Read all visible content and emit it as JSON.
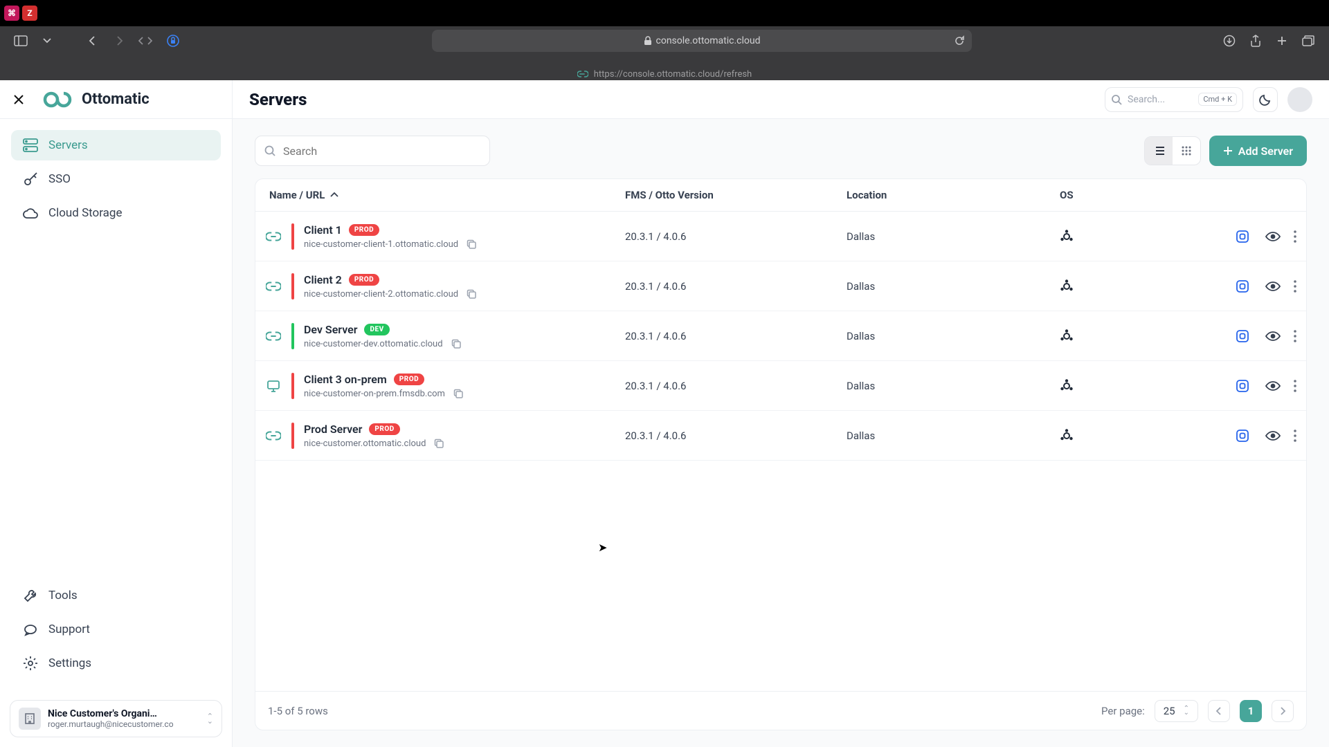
{
  "browser": {
    "url_display": "console.ottomatic.cloud",
    "secondary_url": "https://console.ottomatic.cloud/refresh"
  },
  "app": {
    "brand": "Ottomatic",
    "page_title": "Servers"
  },
  "sidebar": {
    "items": [
      {
        "label": "Servers"
      },
      {
        "label": "SSO"
      },
      {
        "label": "Cloud Storage"
      }
    ],
    "bottom_items": [
      {
        "label": "Tools"
      },
      {
        "label": "Support"
      },
      {
        "label": "Settings"
      }
    ],
    "org": {
      "name": "Nice Customer's Organi…",
      "email": "roger.murtaugh@nicecustomer.co"
    }
  },
  "header": {
    "search_placeholder": "Search...",
    "search_kbd": "Cmd  +  K"
  },
  "toolbar": {
    "filter_placeholder": "Search",
    "add_label": "Add Server"
  },
  "columns": {
    "name": "Name / URL",
    "version": "FMS / Otto Version",
    "location": "Location",
    "os": "OS"
  },
  "servers": [
    {
      "name": "Client 1",
      "env": "PROD",
      "env_class": "prod",
      "url": "nice-customer-client-1.ottomatic.cloud",
      "version": "20.3.1 / 4.0.6",
      "location": "Dallas",
      "type": "cloud"
    },
    {
      "name": "Client 2",
      "env": "PROD",
      "env_class": "prod",
      "url": "nice-customer-client-2.ottomatic.cloud",
      "version": "20.3.1 / 4.0.6",
      "location": "Dallas",
      "type": "cloud"
    },
    {
      "name": "Dev Server",
      "env": "DEV",
      "env_class": "dev",
      "url": "nice-customer-dev.ottomatic.cloud",
      "version": "20.3.1 / 4.0.6",
      "location": "Dallas",
      "type": "cloud"
    },
    {
      "name": "Client 3 on-prem",
      "env": "PROD",
      "env_class": "prod",
      "url": "nice-customer-on-prem.fmsdb.com",
      "version": "20.3.1 / 4.0.6",
      "location": "Dallas",
      "type": "onprem"
    },
    {
      "name": "Prod Server",
      "env": "PROD",
      "env_class": "prod",
      "url": "nice-customer.ottomatic.cloud",
      "version": "20.3.1 / 4.0.6",
      "location": "Dallas",
      "type": "cloud"
    }
  ],
  "footer": {
    "range": "1-5 of 5 rows",
    "per_page_label": "Per page:",
    "per_page_value": "25",
    "page_current": "1"
  }
}
